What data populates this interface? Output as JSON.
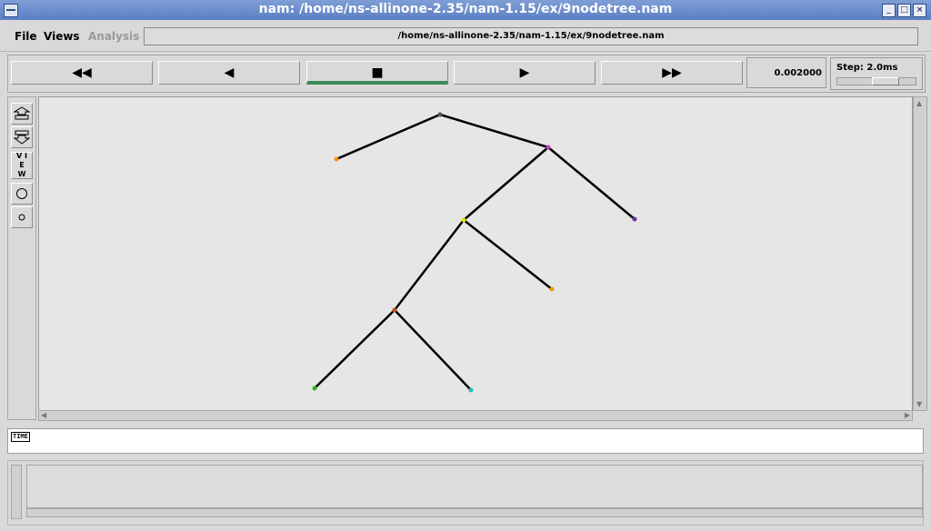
{
  "window": {
    "title": "nam: /home/ns-allinone-2.35/nam-1.15/ex/9nodetree.nam",
    "controls": [
      "_",
      "□",
      "×"
    ]
  },
  "menu": {
    "file": "File",
    "views": "Views",
    "analysis": "Analysis",
    "path": "/home/ns-allinone-2.35/nam-1.15/ex/9nodetree.nam"
  },
  "controls": {
    "rewind_icon": "◀◀",
    "back_icon": "◀",
    "stop_icon": "■",
    "play_icon": "▶",
    "fastforward_icon": "▶▶",
    "time": "0.002000",
    "step": "Step: 2.0ms",
    "active_button": "stop"
  },
  "tools": {
    "view_label": "V I E W"
  },
  "timeline": {
    "label": "TIME"
  },
  "network": {
    "nodes": [
      {
        "id": "n0",
        "color": "#555555"
      },
      {
        "id": "n1",
        "color": "#ff8c00"
      },
      {
        "id": "n2",
        "color": "#c040c0"
      },
      {
        "id": "n3",
        "color": "#e0e000"
      },
      {
        "id": "n4",
        "color": "#7030a0"
      },
      {
        "id": "n5",
        "color": "#e0a000"
      },
      {
        "id": "n6",
        "color": "#c05020"
      },
      {
        "id": "n7",
        "color": "#20c020"
      },
      {
        "id": "n8",
        "color": "#20c0c0"
      }
    ],
    "links": [
      [
        "n0",
        "n1"
      ],
      [
        "n0",
        "n2"
      ],
      [
        "n2",
        "n3"
      ],
      [
        "n2",
        "n4"
      ],
      [
        "n3",
        "n5"
      ],
      [
        "n3",
        "n6"
      ],
      [
        "n6",
        "n7"
      ],
      [
        "n6",
        "n8"
      ]
    ]
  }
}
